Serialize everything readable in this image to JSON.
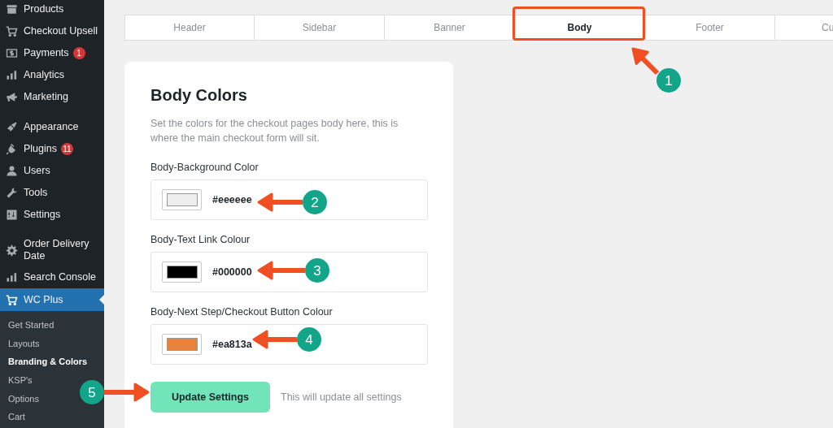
{
  "sidebar": {
    "items": [
      {
        "label": "Products",
        "selected": false
      },
      {
        "label": "Checkout Upsell",
        "selected": false
      },
      {
        "label": "Payments",
        "badge": "1",
        "selected": false
      },
      {
        "label": "Analytics",
        "selected": false
      },
      {
        "label": "Marketing",
        "selected": false
      },
      {
        "label": "Appearance",
        "selected": false
      },
      {
        "label": "Plugins",
        "badge": "11",
        "selected": false
      },
      {
        "label": "Users",
        "selected": false
      },
      {
        "label": "Tools",
        "selected": false
      },
      {
        "label": "Settings",
        "selected": false
      },
      {
        "label": "Order Delivery Date",
        "selected": false
      },
      {
        "label": "Search Console",
        "selected": false
      },
      {
        "label": "WC Plus",
        "selected": true
      }
    ],
    "submenu": [
      {
        "label": "Get Started",
        "selected": false
      },
      {
        "label": "Layouts",
        "selected": false
      },
      {
        "label": "Branding & Colors",
        "selected": true
      },
      {
        "label": "KSP's",
        "selected": false
      },
      {
        "label": "Options",
        "selected": false
      },
      {
        "label": "Cart",
        "selected": false
      }
    ]
  },
  "tabs": [
    {
      "label": "Header",
      "selected": false
    },
    {
      "label": "Sidebar",
      "selected": false
    },
    {
      "label": "Banner",
      "selected": false
    },
    {
      "label": "Body",
      "selected": true
    },
    {
      "label": "Footer",
      "selected": false
    },
    {
      "label": "Cu",
      "selected": false
    }
  ],
  "card": {
    "title": "Body Colors",
    "description": "Set the colors for the checkout pages body here, this is where the main checkout form will sit.",
    "fields": [
      {
        "label": "Body-Background Color",
        "value": "#eeeeee",
        "color": "#eeeeee"
      },
      {
        "label": "Body-Text Link Colour",
        "value": "#000000",
        "color": "#000000"
      },
      {
        "label": "Body-Next Step/Checkout Button Colour",
        "value": "#ea813a",
        "color": "#ea813a"
      }
    ],
    "button": "Update Settings",
    "note": "This will update all settings"
  },
  "annotations": [
    "1",
    "2",
    "3",
    "4",
    "5"
  ]
}
